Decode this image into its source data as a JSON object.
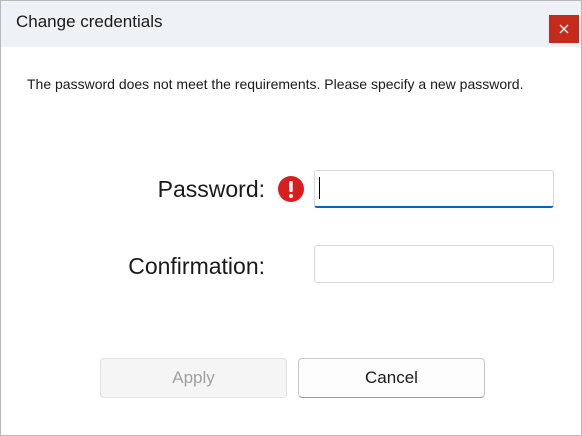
{
  "window": {
    "title": "Change credentials",
    "close_icon": "close-icon"
  },
  "message": "The password does not meet the requirements. Please specify a new password.",
  "form": {
    "password_label": "Password:",
    "password_value": "",
    "password_error_icon": "error-icon",
    "confirmation_label": "Confirmation:",
    "confirmation_value": ""
  },
  "buttons": {
    "apply_label": "Apply",
    "apply_enabled": false,
    "cancel_label": "Cancel"
  },
  "colors": {
    "close_button": "#c42b1c",
    "error_icon": "#d81e1e",
    "focus_underline": "#0067c0",
    "disabled_text": "#a0a0a0"
  }
}
